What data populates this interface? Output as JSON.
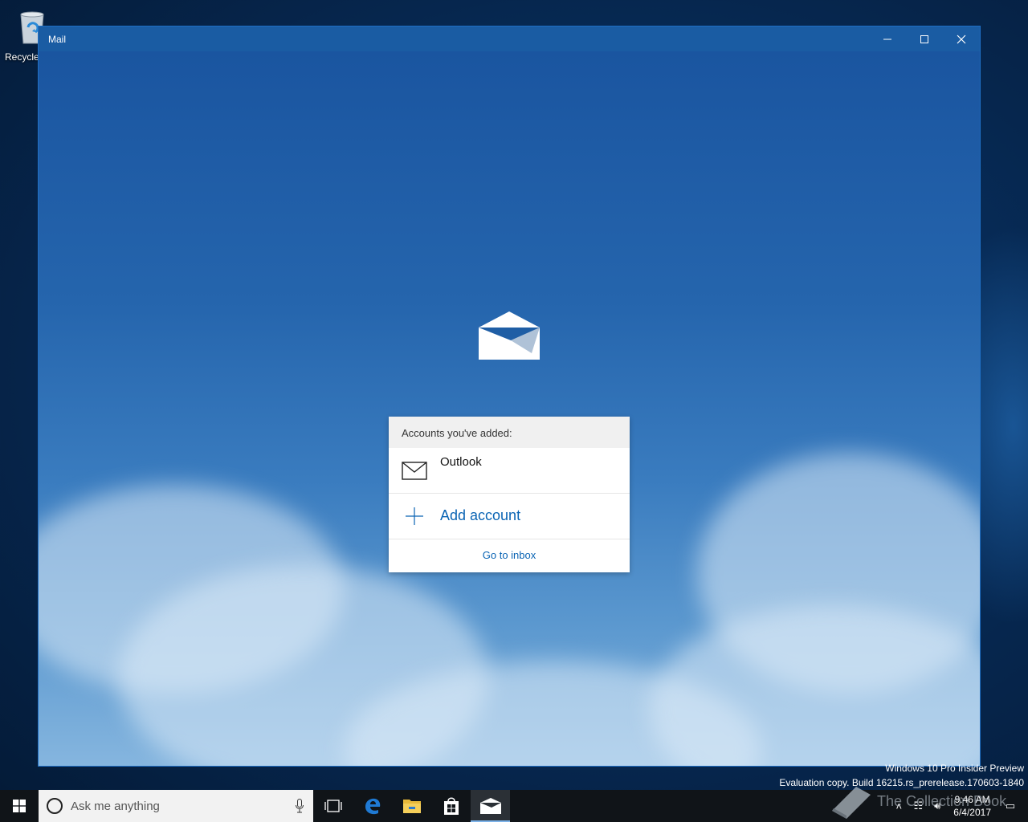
{
  "desktop": {
    "recycle_label": "Recycle",
    "watermark_line1": "Windows 10 Pro Insider Preview",
    "watermark_line2": "Evaluation copy. Build 16215.rs_prerelease.170603-1840",
    "overlay_text": "The Collection Book"
  },
  "window": {
    "title": "Mail",
    "controls": [
      "minimize",
      "maximize",
      "close"
    ]
  },
  "panel": {
    "header": "Accounts you've added:",
    "accounts": [
      {
        "name": "Outlook",
        "icon": "mail-envelope-icon"
      }
    ],
    "add_account": "Add account",
    "go_to_inbox": "Go to inbox"
  },
  "taskbar": {
    "search_placeholder": "Ask me anything",
    "pinned": [
      "task-view-icon",
      "edge-icon",
      "file-explorer-icon",
      "store-icon",
      "mail-icon"
    ],
    "active_app": "mail-icon",
    "clock_time": "9:46 AM",
    "clock_date": "6/4/2017"
  },
  "colors": {
    "accent": "#0a64b4",
    "titlebar": "#1a5ca3",
    "taskbar": "#101418"
  }
}
